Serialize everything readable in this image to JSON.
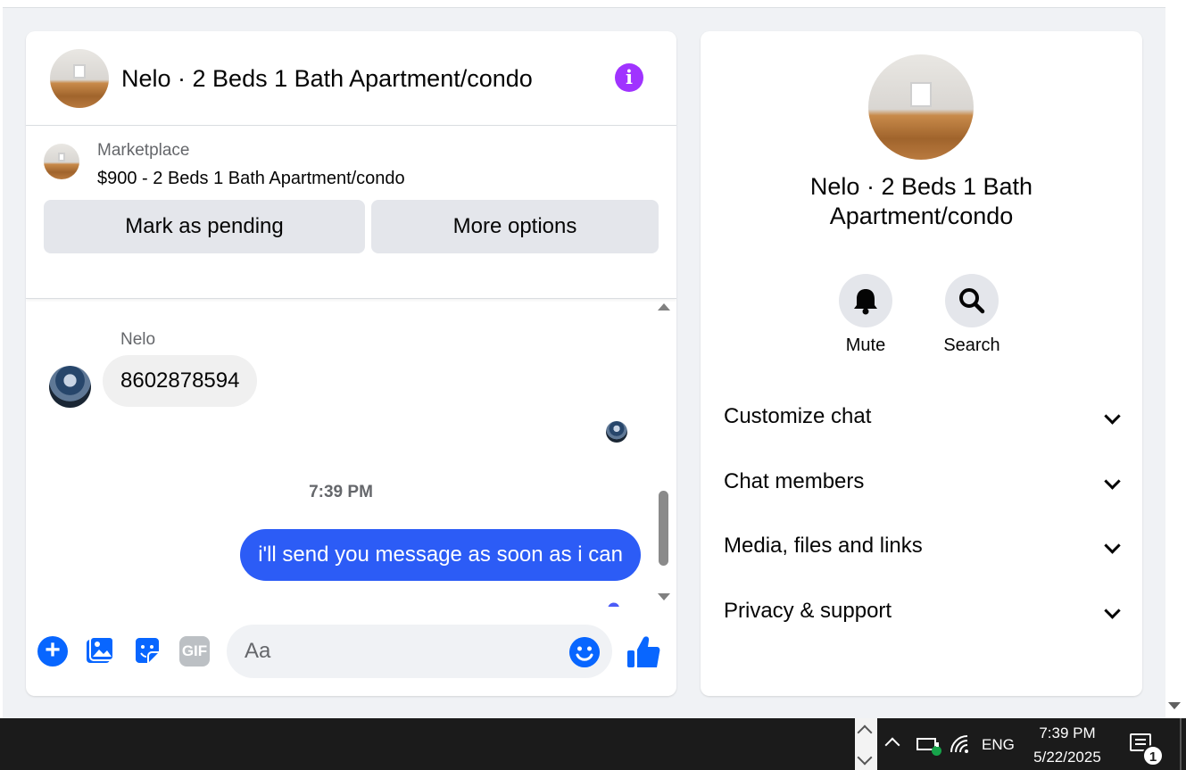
{
  "header": {
    "title": "Nelo · 2 Beds 1 Bath Apartment/condo"
  },
  "listing": {
    "source": "Marketplace",
    "price_title": "$900 - 2 Beds 1 Bath Apartment/condo",
    "mark_pending_label": "Mark as pending",
    "more_options_label": "More options"
  },
  "messages": {
    "sender_name": "Nelo",
    "incoming_text": "8602878594",
    "timestamp": "7:39 PM",
    "outgoing_text": "i'll send you message as soon as i can"
  },
  "composer": {
    "placeholder": "Aa",
    "gif_label": "GIF",
    "plus_label": "+"
  },
  "info_panel": {
    "title": "Nelo · 2 Beds 1 Bath Apartment/condo",
    "mute_label": "Mute",
    "search_label": "Search",
    "sections": [
      {
        "label": "Customize chat"
      },
      {
        "label": "Chat members"
      },
      {
        "label": "Media, files and links"
      },
      {
        "label": "Privacy & support"
      }
    ]
  },
  "taskbar": {
    "language": "ENG",
    "time": "7:39 PM",
    "date": "5/22/2025",
    "notification_count": "1"
  },
  "colors": {
    "messenger_blue": "#0866ff",
    "outgoing_bubble": "#2c5cf6",
    "info_purple": "#a033ff"
  }
}
